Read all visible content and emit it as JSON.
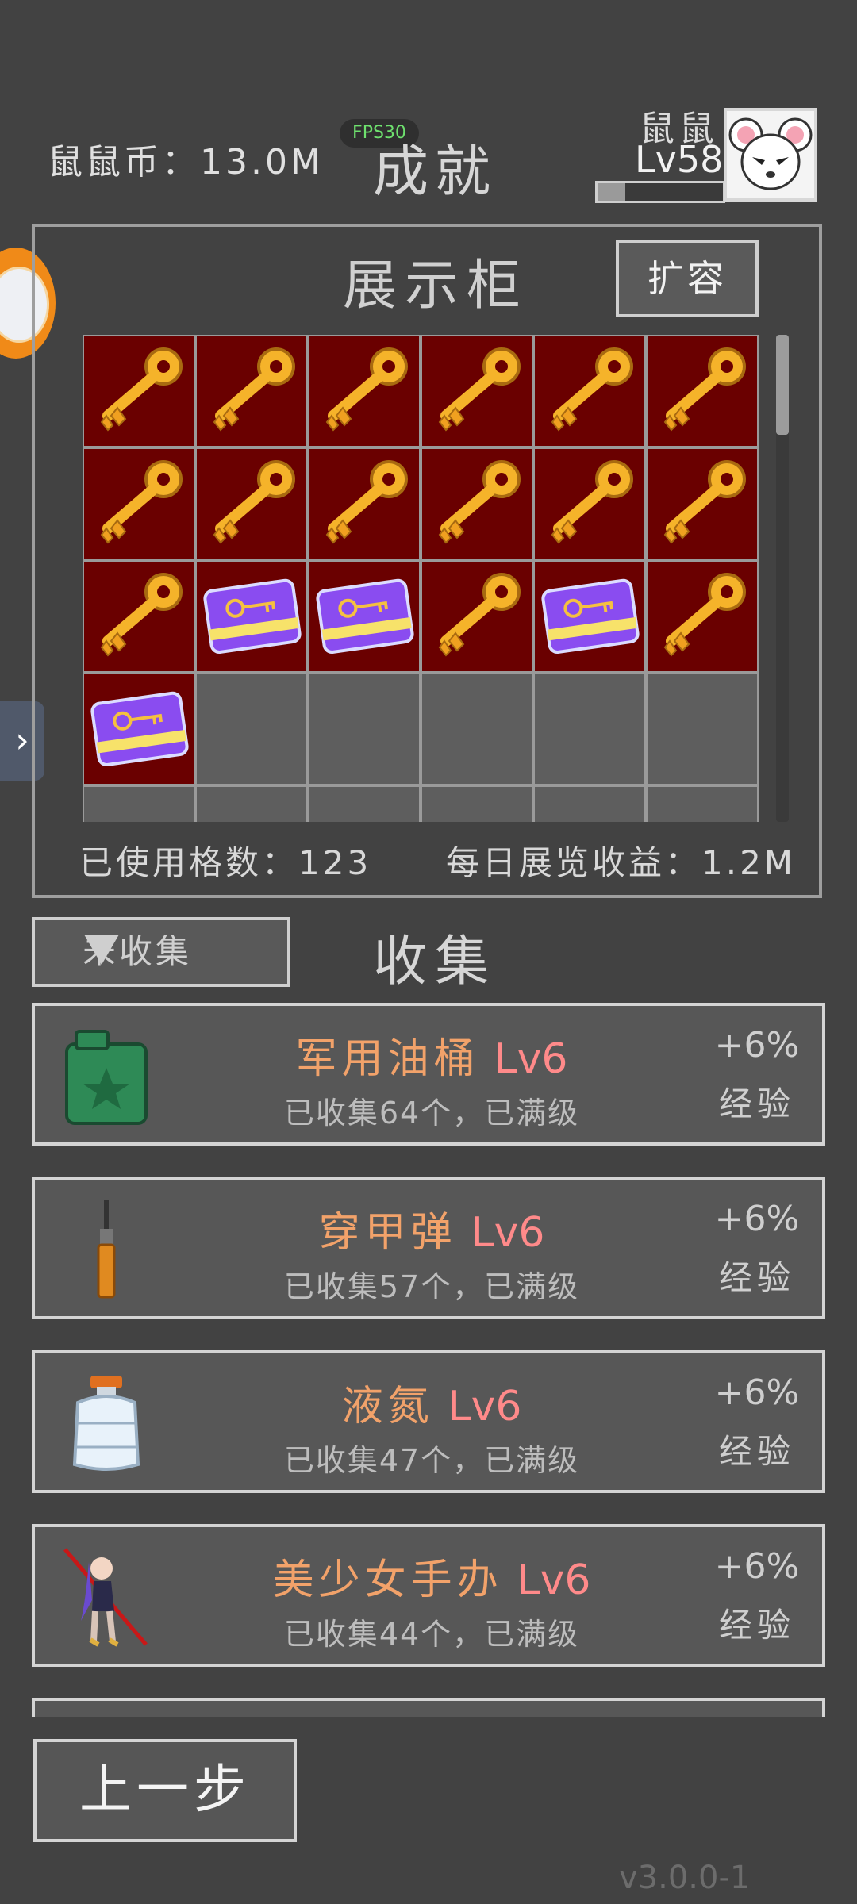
{
  "header": {
    "currency_text": "鼠鼠币：13.0M",
    "fps": "FPS30",
    "title": "成就",
    "player_name": "鼠鼠",
    "player_level": "Lv58",
    "xp_fraction": 0.22
  },
  "showcase": {
    "title": "展示柜",
    "expand_label": "扩容",
    "used_slots_text": "已使用格数：123",
    "daily_income_text": "每日展览收益：1.2M",
    "grid_columns": 6,
    "cells": [
      "key-icon",
      "key-icon",
      "key-icon",
      "key-icon",
      "key-icon",
      "key-icon",
      "key-icon",
      "key-icon",
      "key-icon",
      "key-icon",
      "key-icon",
      "key-icon",
      "key-icon",
      "keycard-icon",
      "keycard-icon",
      "key-icon",
      "keycard-icon",
      "key-icon",
      "keycard-icon",
      "empty",
      "empty",
      "empty",
      "empty",
      "empty",
      "empty",
      "empty",
      "empty",
      "empty",
      "empty",
      "empty"
    ]
  },
  "collection": {
    "filter_label": "未收集",
    "title": "收集",
    "items": [
      {
        "icon": "jerrycan-icon",
        "name": "军用油桶",
        "level": "Lv6",
        "desc": "已收集64个，已满级",
        "bonus": "+6%",
        "bonus_label": "经验"
      },
      {
        "icon": "ap-round-icon",
        "name": "穿甲弹",
        "level": "Lv6",
        "desc": "已收集57个，已满级",
        "bonus": "+6%",
        "bonus_label": "经验"
      },
      {
        "icon": "liquid-nitrogen-icon",
        "name": "液氮",
        "level": "Lv6",
        "desc": "已收集47个，已满级",
        "bonus": "+6%",
        "bonus_label": "经验"
      },
      {
        "icon": "figure-icon",
        "name": "美少女手办",
        "level": "Lv6",
        "desc": "已收集44个，已满级",
        "bonus": "+6%",
        "bonus_label": "经验"
      }
    ]
  },
  "back_label": "上一步",
  "version": "v3.0.0-1",
  "colors": {
    "cell_filled": "#6a0000",
    "name_orange": "#f2a26a",
    "level_pink": "#ff8a8a",
    "fps_green": "#6ee06e"
  }
}
